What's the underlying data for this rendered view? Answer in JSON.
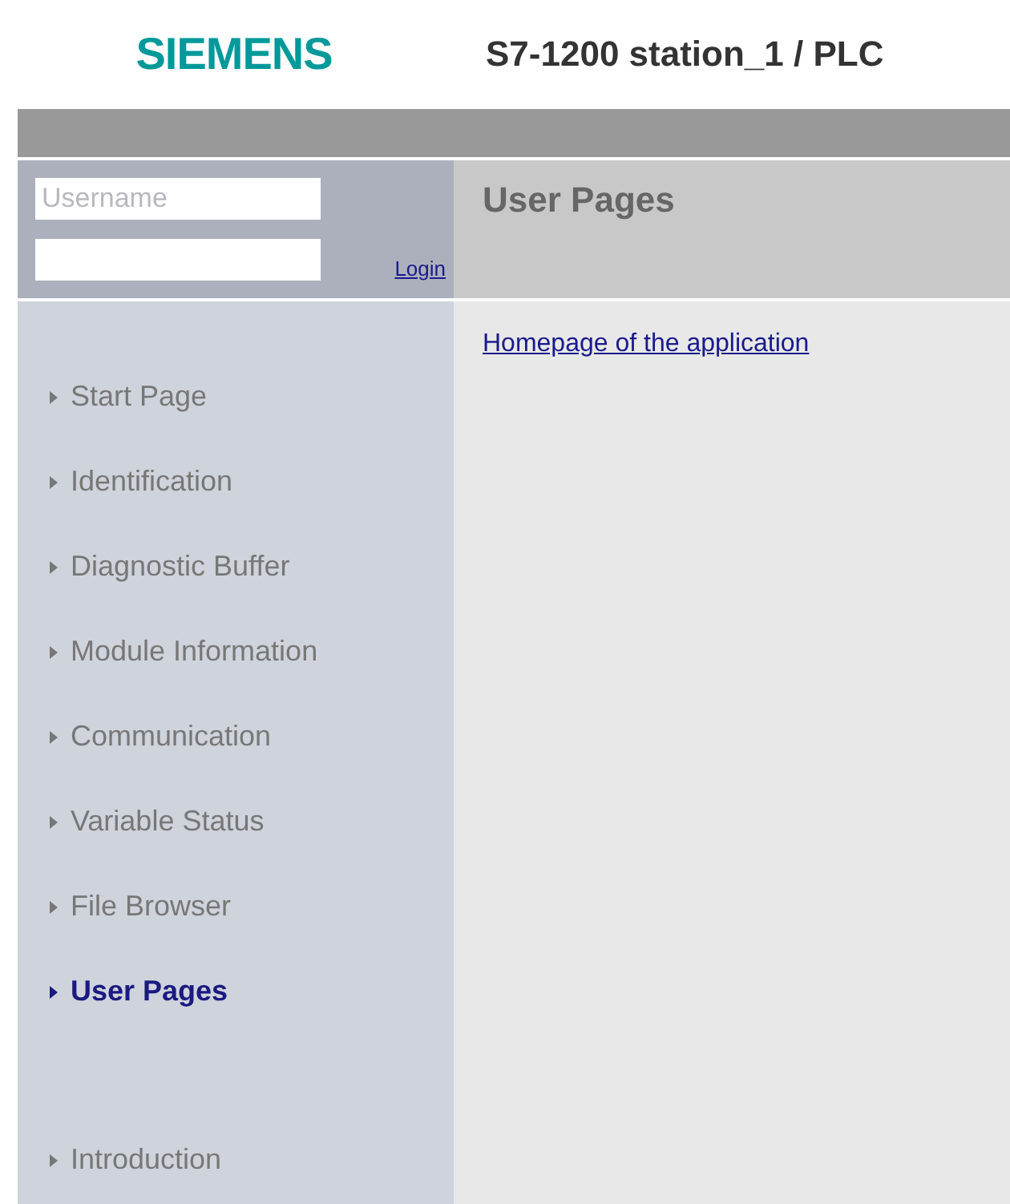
{
  "header": {
    "logo": "SIEMENS",
    "title": "S7-1200 station_1 / PLC"
  },
  "login": {
    "username_placeholder": "Username",
    "login_link": "Login"
  },
  "nav": [
    {
      "label": "Start Page",
      "selected": false
    },
    {
      "label": "Identification",
      "selected": false
    },
    {
      "label": "Diagnostic Buffer",
      "selected": false
    },
    {
      "label": "Module Information",
      "selected": false
    },
    {
      "label": "Communication",
      "selected": false
    },
    {
      "label": "Variable Status",
      "selected": false
    },
    {
      "label": "File Browser",
      "selected": false
    },
    {
      "label": "User Pages",
      "selected": true
    }
  ],
  "nav_bottom": [
    {
      "label": "Introduction",
      "selected": false
    }
  ],
  "content": {
    "title": "User Pages",
    "links": [
      "Homepage of the application"
    ]
  }
}
